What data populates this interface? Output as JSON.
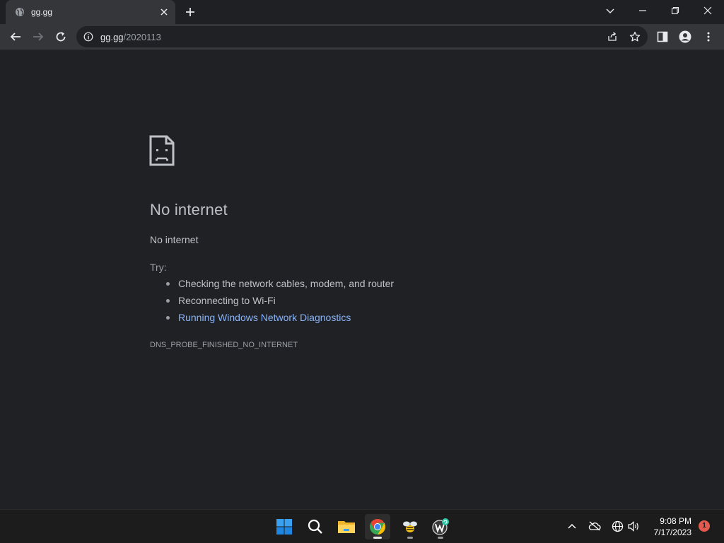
{
  "browser": {
    "tab": {
      "title": "gg.gg",
      "favicon": "globe-icon"
    },
    "address": {
      "host": "gg.gg",
      "path": "/2020113"
    }
  },
  "error": {
    "heading": "No internet",
    "subtitle": "No internet",
    "try_label": "Try:",
    "suggestions": [
      "Checking the network cables, modem, and router",
      "Reconnecting to Wi-Fi",
      "Running Windows Network Diagnostics"
    ],
    "code": "DNS_PROBE_FINISHED_NO_INTERNET"
  },
  "taskbar": {
    "clock_time": "9:08 PM",
    "clock_date": "7/17/2023",
    "notification_count": "1"
  },
  "colors": {
    "link": "#8ab4f8",
    "text": "#bdc1c6",
    "background": "#202124"
  }
}
